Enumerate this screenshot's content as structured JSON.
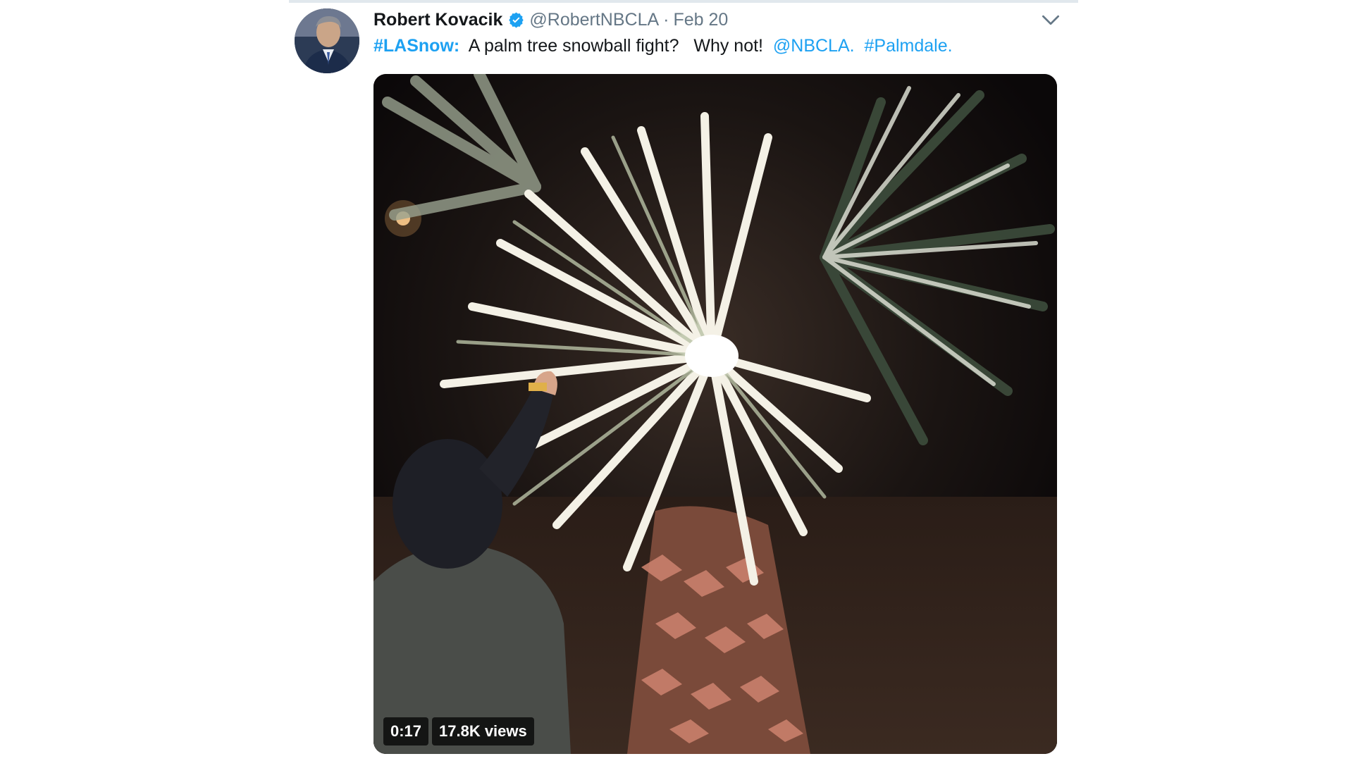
{
  "tweet": {
    "author": {
      "display_name": "Robert Kovacik",
      "verified": true,
      "handle": "@RobertNBCLA",
      "separator": "·",
      "date": "Feb 20"
    },
    "text_parts": [
      {
        "type": "hashtag",
        "text": "#LASnow:"
      },
      {
        "type": "text",
        "text": "  A palm tree snowball fight?   Why not!  "
      },
      {
        "type": "mention",
        "text": "@NBCLA."
      },
      {
        "type": "text",
        "text": "  "
      },
      {
        "type": "hashtag",
        "text": "#Palmdale."
      }
    ],
    "media": {
      "kind": "video",
      "duration": "0:17",
      "views": "17.8K views"
    },
    "more_menu_icon": "chevron-down-icon"
  },
  "colors": {
    "link": "#1da1f2",
    "verified_badge": "#1da1f2",
    "text_primary": "#14171a",
    "text_secondary": "#657786",
    "divider": "#e1e8ed"
  }
}
